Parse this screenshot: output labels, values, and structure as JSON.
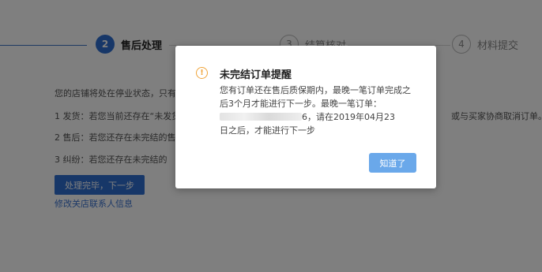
{
  "stepper": {
    "steps": [
      {
        "number": "2",
        "label": "售后处理",
        "state": "active"
      },
      {
        "number": "3",
        "label": "结算核对",
        "state": "todo"
      },
      {
        "number": "4",
        "label": "材料提交",
        "state": "todo"
      }
    ]
  },
  "content": {
    "status_text": "您的店铺将处在停业状态，只有",
    "item1": "1 发货：若您当前还存在“未发货",
    "item1_tail": "或与买家协商取消订单。",
    "item2": "2 售后：若您还存在未完结的售",
    "item3": "3 纠纷：若您还存在未完结的",
    "next_button": "处理完毕，下一步",
    "edit_link": "修改关店联系人信息"
  },
  "modal": {
    "icon": "warning-icon",
    "title": "未完结订单提醒",
    "line1": "您有订单还在售后质保期内，最晚一笔订单完成之",
    "line2": "后3个月才能进行下一步。最晚一笔订单：",
    "line3_suffix": "6，请在2019年04月23",
    "line4": "日之后，才能进行下一步",
    "ok_button": "知道了"
  },
  "colors": {
    "accent": "#2f6fd1",
    "warning": "#f0a43a",
    "ok_button": "#6aa8ea",
    "overlay": "rgba(0,0,0,0.5)"
  }
}
